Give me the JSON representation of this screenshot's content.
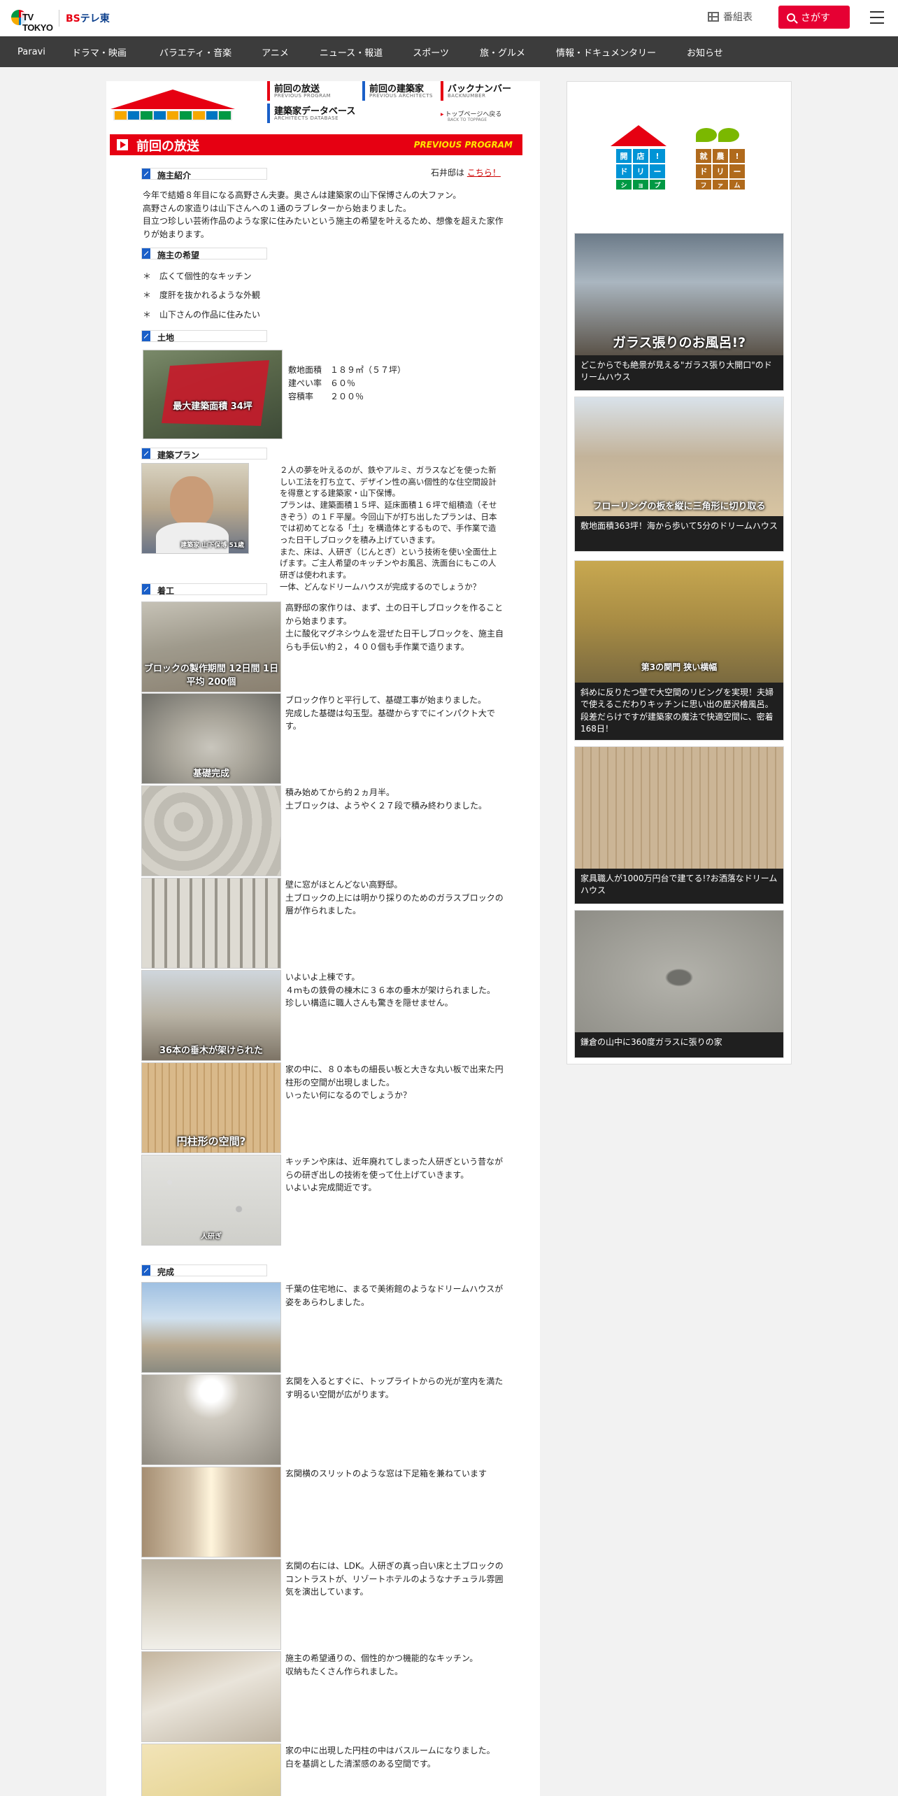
{
  "header": {
    "logo_tv": "TV TOKYO",
    "logo_bs": "BS",
    "logo_bs_rest": "テレ東",
    "program_guide": "番組表",
    "search": "さがす"
  },
  "nav": [
    "Paravi",
    "ドラマ・映画",
    "バラエティ・音楽",
    "アニメ",
    "ニュース・報道",
    "スポーツ",
    "旅・グルメ",
    "情報・ドキュメンタリー",
    "お知らせ"
  ],
  "main_nav": {
    "prev_program": "前回の放送",
    "prev_program_en": "PREVIOUS PROGRAM",
    "prev_architects": "前回の建築家",
    "prev_architects_en": "PREVIOUS ARCHITECTS",
    "backnumber": "バックナンバー",
    "backnumber_en": "BACKNUMBER",
    "architects_db": "建築家データベース",
    "architects_db_en": "ARCHITECTS DATABASE",
    "to_top": "トップページへ戻る",
    "to_top_en": "BACK TO TOPPAGE"
  },
  "page_title": "前回の放送",
  "page_title_en": "PREVIOUS PROGRAM",
  "ishii_prefix": "石井邸は",
  "ishii_link": "こちら！",
  "sections": {
    "client_intro": "施主紹介",
    "client_wishes": "施主の希望",
    "land": "土地",
    "plan": "建築プラン",
    "construction": "着工",
    "completion": "完成"
  },
  "intro_text": "今年で結婚８年目になる高野さん夫妻。奥さんは建築家の山下保博さんの大ファン。\n高野さんの家造りは山下さんへの１通のラブレターから始まりました。\n目立つ珍しい芸術作品のような家に住みたいという施主の希望を叶えるため、想像を超えた家作りが始まります。",
  "wishes": [
    "広くて個性的なキッチン",
    "度肝を抜かれるような外観",
    "山下さんの作品に住みたい"
  ],
  "land_spec": {
    "area_label": "敷地面積",
    "area_value": "１８９㎡（５７坪）",
    "coverage_label": "建ぺい率",
    "coverage_value": "６０％",
    "far_label": "容積率",
    "far_value": "２００％",
    "photo_caption": "最大建築面積 34坪"
  },
  "plan_text": "２人の夢を叶えるのが、鉄やアルミ、ガラスなどを使った新しい工法を打ち立て、デザイン性の高い個性的な住空間設計を得意とする建築家・山下保博。\nプランは、建築面積１５坪、延床面積１６坪で組積造（そせきぞう）の１Ｆ平屋。今回山下が打ち出したプランは、日本では初めてとなる「土」を構造体とするもので、手作業で造った日干しブロックを積み上げていきます。\nまた、床は、人研ぎ（じんとぎ）という技術を使い全面仕上げます。ご主人希望のキッチンやお風呂、洗面台にもこの人研ぎは使われます。\n一体、どんなドリームハウスが完成するのでしょうか？",
  "plan_photo_caption": "建築家 山下保博 51歳",
  "construction": [
    {
      "text": "高野邸の家作りは、まず、土の日干しブロックを作ることから始まります。\n土に酸化マグネシウムを混ぜた日干しブロックを、施主自らも手伝い約２，４００個も手作業で造ります。",
      "caption": "ブロックの製作期間 12日間 1日平均 200個"
    },
    {
      "text": "ブロック作りと平行して、基礎工事が始まりました。\n完成した基礎は勾玉型。基礎からすでにインパクト大です。",
      "caption": "基礎完成"
    },
    {
      "text": "積み始めてから約２ヵ月半。\n土ブロックは、ようやく２７段で積み終わりました。",
      "caption": ""
    },
    {
      "text": "壁に窓がほとんどない高野邸。\n土ブロックの上には明かり採りのためのガラスブロックの層が作られました。",
      "caption": ""
    },
    {
      "text": "いよいよ上棟です。\n４ｍもの鉄骨の棟木に３６本の垂木が架けられました。\n珍しい構造に職人さんも驚きを隠せません。",
      "caption": "36本の垂木が架けられた"
    },
    {
      "text": "家の中に、８０本もの細長い板と大きな丸い板で出来た円柱形の空間が出現しました。\nいったい何になるのでしょうか？",
      "caption": "円柱形の空間?"
    },
    {
      "text": "キッチンや床は、近年廃れてしまった人研ぎという昔ながらの研ぎ出しの技術を使って仕上げていきます。\nいよいよ完成間近です。",
      "caption": "人研ぎ"
    }
  ],
  "completion": [
    {
      "text": "千葉の住宅地に、まるで美術館のようなドリームハウスが姿をあらわしました。"
    },
    {
      "text": "玄関を入るとすぐに、トップライトからの光が室内を満たす明るい空間が広がります。"
    },
    {
      "text": "玄関横のスリットのような窓は下足箱を兼ねています"
    },
    {
      "text": "玄関の右には、LDK。人研ぎの真っ白い床と土ブロックのコントラストが、リゾートホテルのようなナチュラル雰囲気を演出しています。"
    },
    {
      "text": "施主の希望通りの、個性的かつ機能的なキッチン。\n収納もたくさん作られました。"
    },
    {
      "text": "家の中に出現した円柱の中はバスルームになりました。\n白を基調とした清潔感のある空間です。"
    }
  ],
  "sidebar": {
    "logo1": [
      "開",
      "店",
      "!",
      "ド",
      "リ",
      "ー",
      "ム",
      "シ",
      "ョ",
      "ッ",
      "プ"
    ],
    "logo2": [
      "就",
      "農",
      "!",
      "ド",
      "リ",
      "ー",
      "ム",
      "フ",
      "ァ",
      "ー",
      "ム"
    ],
    "cards": [
      {
        "overlay": "ガラス張りのお風呂!?",
        "desc": "どこからでも絶景が見える\"ガラス張り大開口\"のドリームハウス"
      },
      {
        "overlay": "フローリングの板を縦に三角形に切り取る",
        "desc": "敷地面積363坪！海から歩いて5分のドリームハウス"
      },
      {
        "overlay": "第3の関門 狭い横幅",
        "desc": "斜めに反りたつ壁で大空間のリビングを実現！夫婦で使えるこだわりキッチンに思い出の歴沢檜風呂。段差だらけですが建築家の魔法で快適空間に、密着168日！"
      },
      {
        "overlay": "",
        "desc": "家具職人が1000万円台で建てる!?お洒落なドリームハウス"
      },
      {
        "overlay": "",
        "desc": "鎌倉の山中に360度ガラスに張りの家"
      }
    ]
  },
  "colors": {
    "brand_red": "#e60012",
    "search_red": "#e60033",
    "nav_bg": "#3c3c3c"
  }
}
